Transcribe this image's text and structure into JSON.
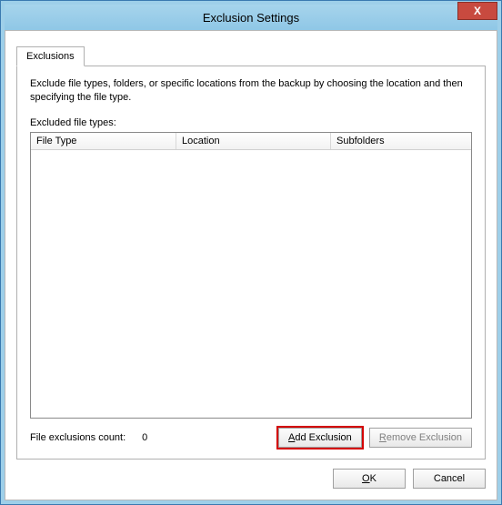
{
  "window": {
    "title": "Exclusion Settings",
    "close_symbol": "X"
  },
  "tab": {
    "label": "Exclusions"
  },
  "content": {
    "description": "Exclude file types, folders, or specific locations from the backup by choosing the location and then specifying the file type.",
    "excluded_label": "Excluded file types:",
    "columns": {
      "file_type": "File Type",
      "location": "Location",
      "subfolders": "Subfolders"
    },
    "rows": [],
    "count_label": "File exclusions count:",
    "count_value": "0",
    "add_button": "Add Exclusion",
    "remove_button": "Remove Exclusion"
  },
  "dialog": {
    "ok": "OK",
    "cancel": "Cancel"
  }
}
